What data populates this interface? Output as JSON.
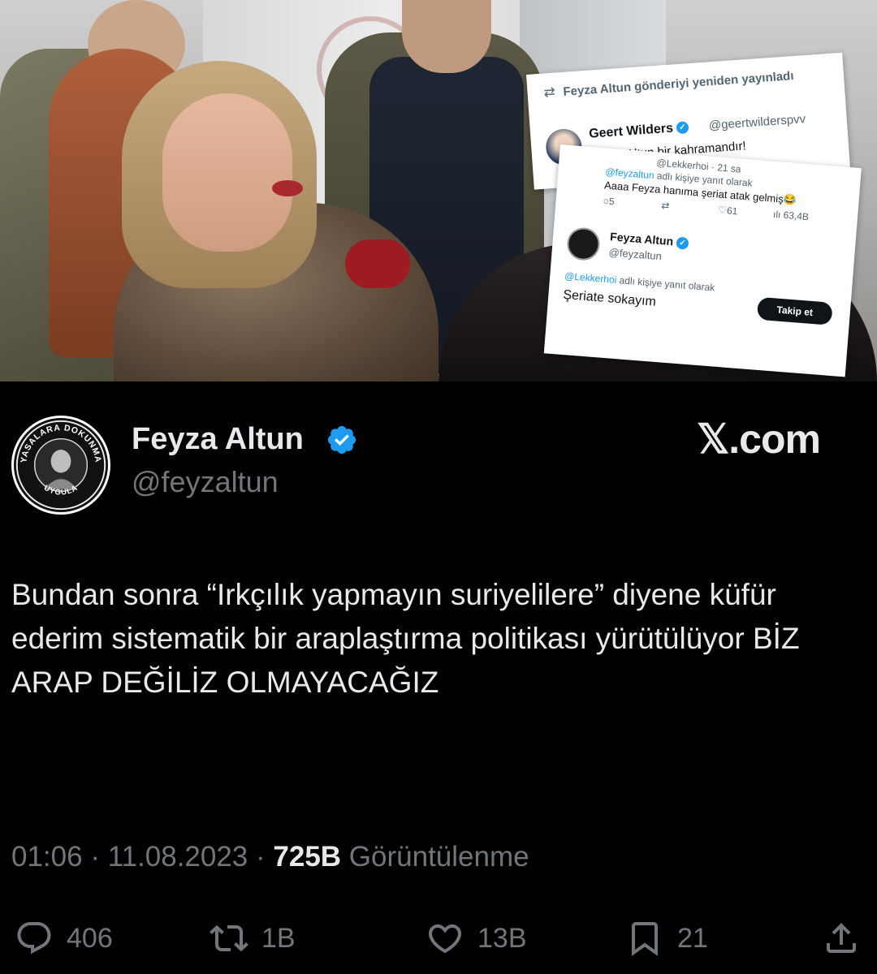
{
  "embedded": {
    "card1": {
      "retweet_line": "Feyza Altun gönderiyi yeniden yayınladı",
      "name": "Geert Wilders",
      "handle": "@geertwilderspvv",
      "text": "Feyza Altun bir kahramandır!"
    },
    "card2": {
      "reply_meta": "@Lekkerhoi · 21 sa",
      "reply_to_handle": "@feyzaltun",
      "reply_to_suffix": "adlı kişiye yanıt olarak",
      "reply_text": "Aaaa Feyza hanıma şeriat atak gelmiş😂",
      "stat_replies": "5",
      "stat_likes": "61",
      "stat_views": "63,4B",
      "name": "Feyza Altun",
      "handle": "@feyzaltun",
      "follow_label": "Takip et",
      "reply2_handle": "@Lekkerhoi",
      "reply2_suffix": "adlı kişiye yanıt olarak",
      "text": "Şeriate sokayım"
    }
  },
  "tweet": {
    "author_name": "Feyza Altun",
    "author_handle": "@feyzaltun",
    "avatar_ring_top": "YASALARA DOKUNMA",
    "avatar_ring_bottom": "UYGULA",
    "source_logo": "𝕏.com",
    "text": "Bundan sonra “Irkçılık yapmayın suriyelilere” diyene küfür ederim sistematik bir araplaştırma politikası yürütülüyor BİZ ARAP DEĞİLİZ OLMAYACAĞIZ",
    "time": "01:06",
    "date": "11.08.2023",
    "views_count": "725B",
    "views_label": "Görüntülenme",
    "actions": {
      "replies": "406",
      "retweets": "1B",
      "likes": "13B",
      "bookmarks": "21"
    }
  },
  "colors": {
    "background": "#000000",
    "text_primary": "#e7e9ea",
    "text_secondary": "#71767b",
    "verified": "#1d9bf0"
  },
  "icons": [
    "verified-badge-icon",
    "reply-icon",
    "retweet-icon",
    "like-icon",
    "bookmark-icon",
    "share-icon"
  ]
}
